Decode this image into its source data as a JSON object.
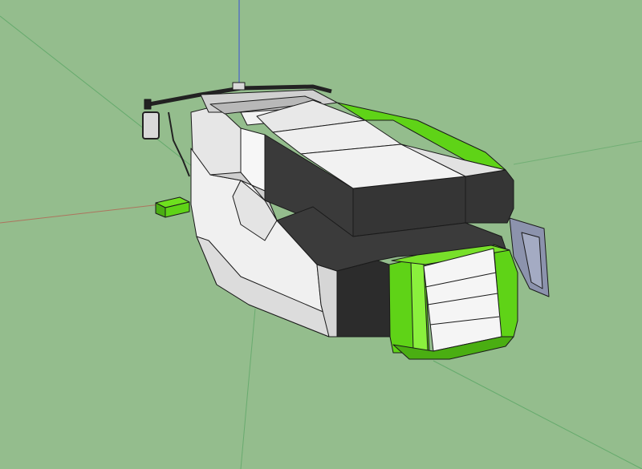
{
  "viewport": {
    "background": "#94bd8d",
    "axes": {
      "red": "#b8554a",
      "green": "#3e9a52",
      "blue": "#3a4fd8"
    }
  },
  "model": {
    "colors": {
      "white": "#f3f3f3",
      "light_gray": "#d9d9d9",
      "mid_gray": "#a9a9a9",
      "dark": "#353535",
      "darker": "#262626",
      "green": "#5fd317",
      "green_dark": "#45a80d",
      "blue_gray": "#8c93ad",
      "edge": "#1a1a1a"
    }
  }
}
